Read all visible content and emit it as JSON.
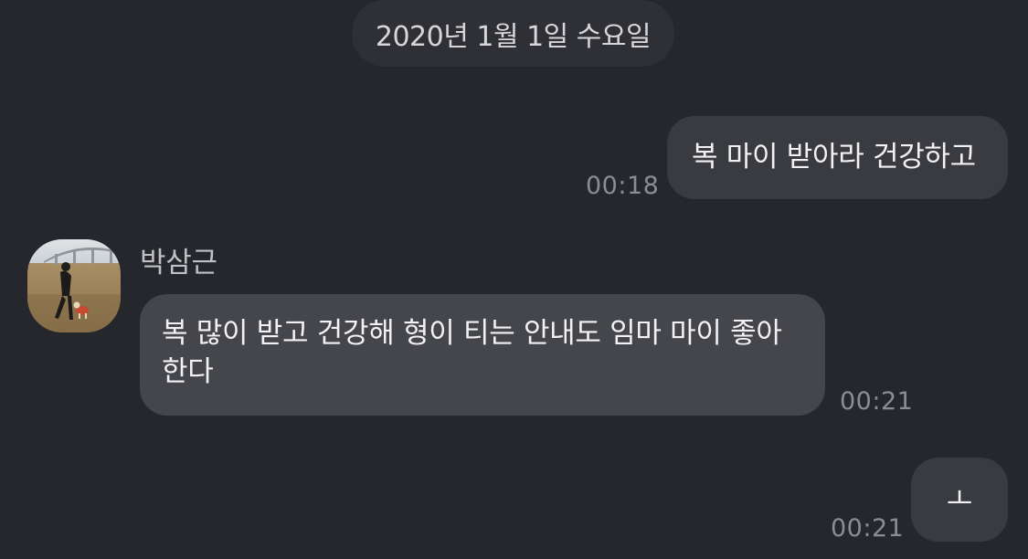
{
  "date_divider": "2020년 1월 1일 수요일",
  "messages": [
    {
      "direction": "outgoing",
      "text": "복 마이 받아라 건강하고",
      "time": "00:18"
    },
    {
      "direction": "incoming",
      "sender": "박삼근",
      "text": "복 많이 받고 건강해 형이 티는 안내도 임마 마이 좋아한다",
      "time": "00:21"
    },
    {
      "direction": "outgoing",
      "text": "ㅗ",
      "time": "00:21"
    }
  ],
  "colors": {
    "background": "#26272c",
    "outgoing_bubble": "#3a3b40",
    "incoming_bubble": "#45464c",
    "date_pill": "#2f3035",
    "timestamp": "#8c8d92"
  },
  "icons": {
    "avatar": "profile-photo-person-with-dog-in-field"
  }
}
